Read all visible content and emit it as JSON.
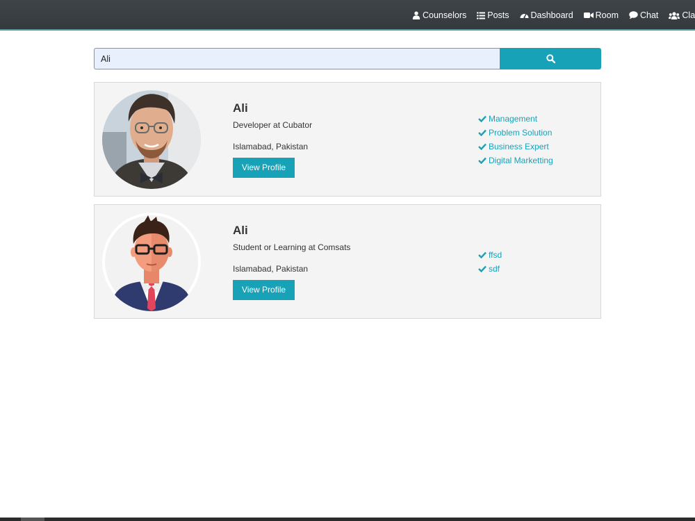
{
  "nav": {
    "items": [
      {
        "label": "Counselors",
        "icon": "user-icon"
      },
      {
        "label": "Posts",
        "icon": "list-icon"
      },
      {
        "label": "Dashboard",
        "icon": "dashboard-icon"
      },
      {
        "label": "Room",
        "icon": "video-icon"
      },
      {
        "label": "Chat",
        "icon": "chat-icon"
      },
      {
        "label": "ClassRo",
        "icon": "users-icon"
      }
    ]
  },
  "search": {
    "value": "Ali",
    "button_icon": "search-icon"
  },
  "results": [
    {
      "name": "Ali",
      "headline": "Developer at Cubator",
      "location": "Islamabad, Pakistan",
      "button_label": "View Profile",
      "avatar": "photo-avatar",
      "skills": [
        "Management",
        "Problem Solution",
        "Business Expert",
        "Digital Marketting"
      ]
    },
    {
      "name": "Ali",
      "headline": "Student or Learning at Comsats",
      "location": "Islamabad, Pakistan",
      "button_label": "View Profile",
      "avatar": "illustrated-avatar",
      "skills": [
        "ffsd",
        "sdf"
      ]
    }
  ],
  "colors": {
    "accent": "#17a2b8",
    "navbar": "#3a3f44",
    "card_bg": "#f4f4f4",
    "input_bg": "#e8f0fe"
  }
}
